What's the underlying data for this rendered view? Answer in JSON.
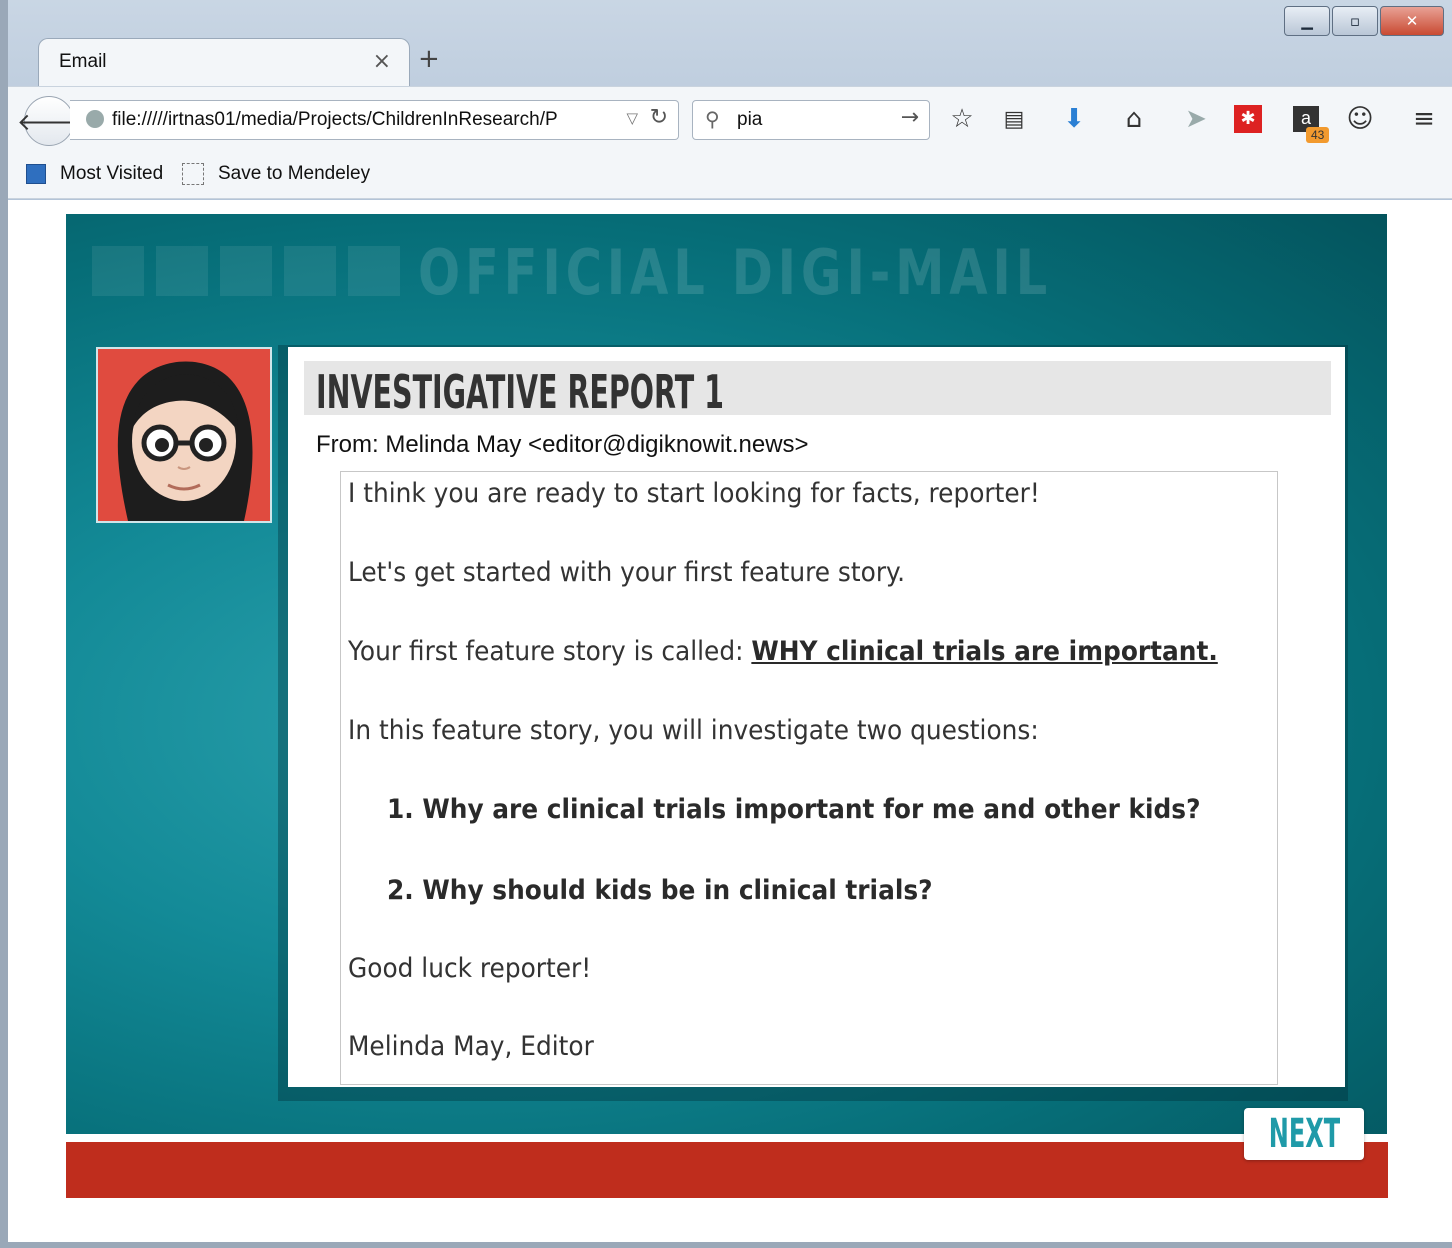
{
  "browser": {
    "tab_title": "Email",
    "tab_close": "×",
    "new_tab": "+",
    "url": "file://///irtnas01/media/Projects/ChildrenInResearch/P",
    "search_value": "pia",
    "badge_count": "43",
    "bookmarks": [
      {
        "label": "Most Visited"
      },
      {
        "label": "Save to Mendeley"
      }
    ]
  },
  "page": {
    "masthead": "OFFICIAL DIGI-MAIL",
    "report_title": "INVESTIGATIVE REPORT 1",
    "from": "From: Melinda May <editor@digiknowit.news>",
    "message": {
      "line1": "I think you are ready to start looking for facts, reporter!",
      "line2": "Let's get started with your first feature story.",
      "line3_prefix": "Your first feature story is called: ",
      "line3_title": "WHY clinical trials are important.",
      "line4": "In this feature story, you will investigate two questions:",
      "q1": "1. Why are clinical trials important for me and other kids?",
      "q2": "2. Why should kids be in clinical trials?",
      "line5": "Good luck reporter!",
      "signature": "Melinda May, Editor"
    },
    "next_label": "NEXT"
  },
  "colors": {
    "teal_bg": "#138a97",
    "footer_red": "#bf2d1d",
    "next_text": "#1f9aa8",
    "avatar_bg": "#e04b3f"
  }
}
